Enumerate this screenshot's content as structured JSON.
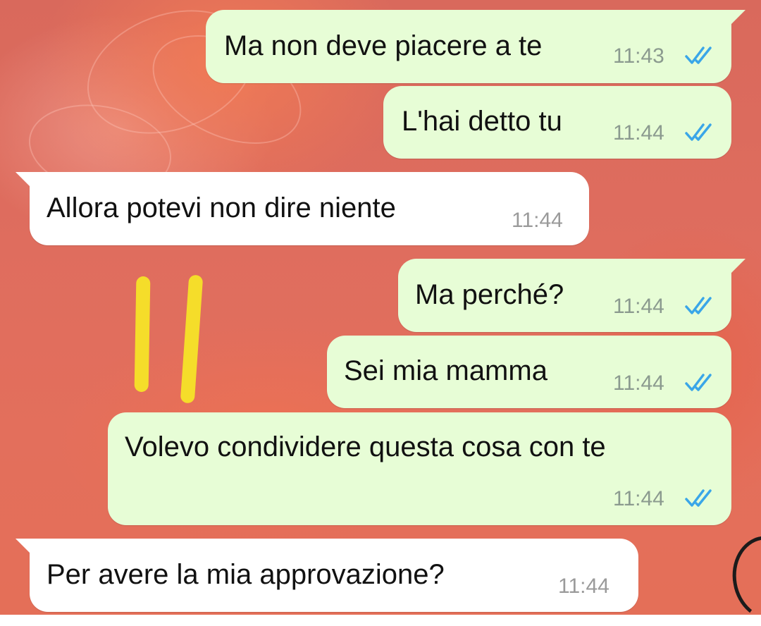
{
  "chat": {
    "messages": [
      {
        "direction": "outgoing",
        "text": "Ma non deve piacere a te",
        "time": "11:43",
        "status": "read"
      },
      {
        "direction": "outgoing",
        "text": "L'hai detto tu",
        "time": "11:44",
        "status": "read"
      },
      {
        "direction": "incoming",
        "text": "Allora potevi non dire niente",
        "time": "11:44"
      },
      {
        "direction": "outgoing",
        "text": "Ma perché?",
        "time": "11:44",
        "status": "read"
      },
      {
        "direction": "outgoing",
        "text": "Sei mia mamma",
        "time": "11:44",
        "status": "read"
      },
      {
        "direction": "outgoing",
        "text": "Volevo condividere questa cosa con te",
        "time": "11:44",
        "status": "read"
      },
      {
        "direction": "incoming",
        "text": "Per avere la mia approvazione?",
        "time": "11:44"
      }
    ]
  },
  "colors": {
    "outgoing_bubble": "#e7fdd6",
    "incoming_bubble": "#ffffff",
    "read_ticks": "#3aa6e8",
    "annotation_marker": "#f5dd2a",
    "wallpaper": "#df6d5e"
  },
  "icons": {
    "read_receipt": "double-check-icon"
  }
}
